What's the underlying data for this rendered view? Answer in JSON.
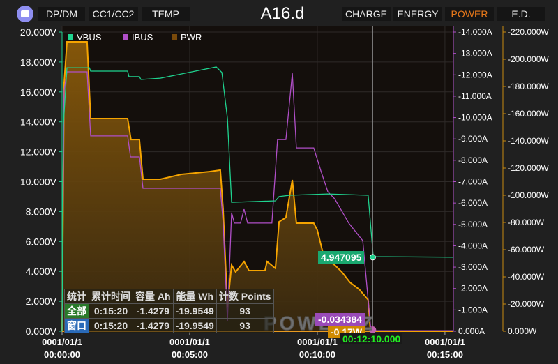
{
  "header": {
    "title": "A16.d",
    "left_tabs": [
      "DP/DM",
      "CC1/CC2",
      "TEMP"
    ],
    "right_tabs": [
      "CHARGE",
      "ENERGY",
      "POWER",
      "E.D."
    ],
    "active_tab": "POWER",
    "logo_icon": "power-z-logo-icon"
  },
  "colors": {
    "vbus": "#1fd38f",
    "ibus": "#b04fc8",
    "pwr": "#f5a400",
    "active_tab": "#e8781a"
  },
  "watermark": "POWER-Z",
  "stats": {
    "headers": [
      "统计",
      "累计时间",
      "容量 Ah",
      "能量 Wh",
      "计数 Points"
    ],
    "rows": [
      {
        "label": "全部",
        "values": [
          "0:15:20",
          "-1.4279",
          "-19.9549",
          "93"
        ]
      },
      {
        "label": "窗口",
        "values": [
          "0:15:20",
          "-1.4279",
          "-19.9549",
          "93"
        ]
      }
    ]
  },
  "cursor": {
    "time": "00:12:10.000",
    "vbus": "4.947095",
    "ibus": "-0.034384",
    "pwr": "-0.17W"
  },
  "chart_data": {
    "type": "line",
    "x_unit": "minutes",
    "x_ticks": [
      {
        "value": 0,
        "label": [
          "0001/01/1",
          "00:00:00"
        ]
      },
      {
        "value": 5,
        "label": [
          "0001/01/1",
          "00:05:00"
        ]
      },
      {
        "value": 10,
        "label": [
          "0001/01/1",
          "00:10:00"
        ]
      },
      {
        "value": 15,
        "label": [
          "0001/01/1",
          "00:15:00"
        ]
      }
    ],
    "xlim": [
      0,
      15.33
    ],
    "axes": {
      "voltage": {
        "ylim": [
          0,
          20
        ],
        "ticks": [
          "0.000V",
          "2.000V",
          "4.000V",
          "6.000V",
          "8.000V",
          "10.000V",
          "12.000V",
          "14.000V",
          "16.000V",
          "18.000V",
          "20.000V"
        ]
      },
      "current": {
        "ylim": [
          0,
          -14
        ],
        "ticks": [
          "0.000A",
          "-1.000A",
          "-2.000A",
          "-3.000A",
          "-4.000A",
          "-5.000A",
          "-6.000A",
          "-7.000A",
          "-8.000A",
          "-9.000A",
          "-10.000A",
          "-11.000A",
          "-12.000A",
          "-13.000A",
          "-14.000A"
        ]
      },
      "power": {
        "ylim": [
          0,
          -220
        ],
        "ticks": [
          "0.000W",
          "-20.000W",
          "-40.000W",
          "-60.000W",
          "-80.000W",
          "-100.000W",
          "-120.000W",
          "-140.000W",
          "-160.000W",
          "-180.000W",
          "-200.000W",
          "-220.000W"
        ]
      }
    },
    "legend": [
      "VBUS",
      "IBUS",
      "PWR"
    ],
    "legend_placement": "top-left",
    "grid": true,
    "series": [
      {
        "name": "VBUS",
        "axis": "voltage",
        "points": [
          [
            0,
            0
          ],
          [
            0.05,
            13.75
          ],
          [
            0.19,
            17.62
          ],
          [
            1.07,
            17.62
          ],
          [
            1.12,
            17.39
          ],
          [
            2.57,
            17.39
          ],
          [
            2.62,
            17.02
          ],
          [
            3.03,
            17.02
          ],
          [
            3.09,
            16.83
          ],
          [
            3.85,
            16.92
          ],
          [
            6.04,
            17.67
          ],
          [
            6.26,
            17.3
          ],
          [
            6.48,
            14.22
          ],
          [
            6.64,
            8.62
          ],
          [
            8.36,
            8.72
          ],
          [
            8.5,
            9.0
          ],
          [
            8.91,
            9.09
          ],
          [
            10.41,
            9.18
          ],
          [
            11.99,
            9.09
          ],
          [
            12.19,
            4.99
          ],
          [
            15.33,
            4.95
          ]
        ]
      },
      {
        "name": "IBUS",
        "axis": "current",
        "points": [
          [
            0,
            0
          ],
          [
            0.08,
            -11.26
          ],
          [
            0.19,
            -12.14
          ],
          [
            0.98,
            -12.14
          ],
          [
            1.12,
            -9.14
          ],
          [
            2.57,
            -9.14
          ],
          [
            2.68,
            -8.16
          ],
          [
            3.03,
            -8.16
          ],
          [
            3.17,
            -6.69
          ],
          [
            6.2,
            -6.69
          ],
          [
            6.31,
            -5.06
          ],
          [
            6.48,
            -0.49
          ],
          [
            6.64,
            -5.55
          ],
          [
            6.75,
            -5.06
          ],
          [
            6.99,
            -5.06
          ],
          [
            7.13,
            -5.71
          ],
          [
            7.27,
            -5.06
          ],
          [
            8.22,
            -5.06
          ],
          [
            8.44,
            -8.97
          ],
          [
            8.77,
            -8.97
          ],
          [
            9.02,
            -12.07
          ],
          [
            9.18,
            -8.58
          ],
          [
            9.86,
            -8.58
          ],
          [
            10.14,
            -7.5
          ],
          [
            10.41,
            -6.53
          ],
          [
            10.68,
            -6.2
          ],
          [
            11.23,
            -5.06
          ],
          [
            11.78,
            -4.24
          ],
          [
            12.1,
            -0.03
          ],
          [
            15.33,
            -0.03
          ]
        ]
      },
      {
        "name": "PWR",
        "axis": "power",
        "points": [
          [
            0,
            0
          ],
          [
            0.08,
            -182.0
          ],
          [
            0.19,
            -212.8
          ],
          [
            0.98,
            -212.8
          ],
          [
            1.12,
            -156.4
          ],
          [
            2.57,
            -156.4
          ],
          [
            2.7,
            -141.0
          ],
          [
            3.03,
            -141.0
          ],
          [
            3.17,
            -111.8
          ],
          [
            3.85,
            -111.8
          ],
          [
            4.67,
            -115.4
          ],
          [
            5.77,
            -117.4
          ],
          [
            6.2,
            -118.5
          ],
          [
            6.31,
            -89.7
          ],
          [
            6.48,
            -17.9
          ],
          [
            6.64,
            -48.7
          ],
          [
            6.8,
            -43.6
          ],
          [
            7.13,
            -51.3
          ],
          [
            7.32,
            -44.6
          ],
          [
            7.95,
            -44.6
          ],
          [
            8.03,
            -51.3
          ],
          [
            8.36,
            -46.2
          ],
          [
            8.5,
            -80.5
          ],
          [
            8.77,
            -83.6
          ],
          [
            9.02,
            -111.3
          ],
          [
            9.18,
            -79.5
          ],
          [
            9.86,
            -79.5
          ],
          [
            10.0,
            -74.4
          ],
          [
            10.27,
            -53.8
          ],
          [
            10.68,
            -48.7
          ],
          [
            10.96,
            -43.6
          ],
          [
            11.28,
            -35.9
          ],
          [
            11.64,
            -30.8
          ],
          [
            11.99,
            -23.1
          ],
          [
            12.08,
            0
          ],
          [
            15.33,
            0
          ]
        ]
      }
    ],
    "cursor_x": 12.17
  }
}
